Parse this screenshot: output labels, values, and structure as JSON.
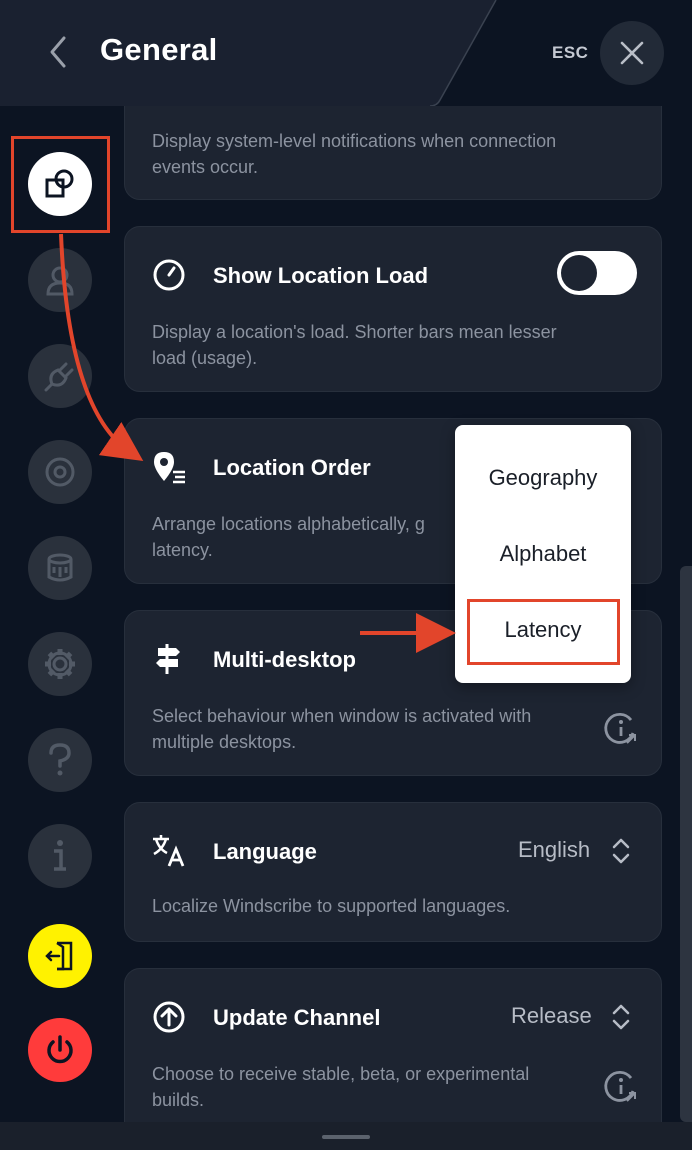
{
  "header": {
    "title": "General",
    "esc_label": "ESC",
    "back_icon": "chevron-left-icon",
    "close_icon": "close-icon"
  },
  "sidebar": {
    "items": [
      {
        "icon": "general-settings-icon",
        "active": true
      },
      {
        "icon": "account-icon"
      },
      {
        "icon": "connection-plug-icon"
      },
      {
        "icon": "robert-icon"
      },
      {
        "icon": "help-me-icon"
      },
      {
        "icon": "advanced-gear-icon"
      },
      {
        "icon": "question-icon"
      },
      {
        "icon": "about-info-icon"
      },
      {
        "icon": "logout-icon",
        "color": "#fff200"
      },
      {
        "icon": "power-icon",
        "color": "#ff3b3b"
      }
    ]
  },
  "cards": {
    "notifications": {
      "desc": "Display system-level notifications when connection events occur."
    },
    "location_load": {
      "title": "Show Location Load",
      "desc": "Display a location's load. Shorter bars mean lesser load (usage).",
      "toggle_state": "on"
    },
    "location_order": {
      "title": "Location Order",
      "desc": "Arrange locations alphabetically, g",
      "desc_line2": "latency."
    },
    "multi_desktop": {
      "title": "Multi-desktop",
      "desc": "Select behaviour when window is activated with multiple desktops."
    },
    "language": {
      "title": "Language",
      "value": "English",
      "desc": "Localize Windscribe to supported languages."
    },
    "update_channel": {
      "title": "Update Channel",
      "value": "Release",
      "desc": "Choose to receive stable, beta, or experimental builds."
    }
  },
  "dropdown": {
    "options": [
      "Geography",
      "Alphabet",
      "Latency"
    ],
    "highlighted": "Latency"
  },
  "colors": {
    "background": "#0c1422",
    "card": "#1d2431",
    "annotation": "#e2452b",
    "logout": "#fff200",
    "power": "#ff3b3b"
  }
}
